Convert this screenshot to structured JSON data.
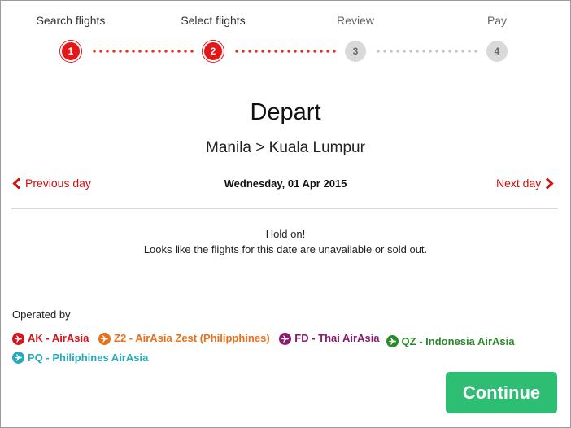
{
  "steps": [
    {
      "label": "Search flights",
      "number": "1",
      "state": "done"
    },
    {
      "label": "Select flights",
      "number": "2",
      "state": "done"
    },
    {
      "label": "Review",
      "number": "3",
      "state": "pending"
    },
    {
      "label": "Pay",
      "number": "4",
      "state": "pending"
    }
  ],
  "header": {
    "title": "Depart",
    "route": "Manila > Kuala Lumpur"
  },
  "date_nav": {
    "previous_label": "Previous day",
    "next_label": "Next day",
    "current_date": "Wednesday, 01 Apr 2015"
  },
  "message": {
    "line1": "Hold on!",
    "line2": "Looks like the flights for this date are unavailable or sold out."
  },
  "operated": {
    "label": "Operated by",
    "airlines": [
      {
        "label": "AK - AirAsia",
        "color": "#d7141a"
      },
      {
        "label": "Z2 - AirAsia Zest (Philipphines)",
        "color": "#e8701a"
      },
      {
        "label": "FD - Thai AirAsia",
        "color": "#8a1a6e"
      },
      {
        "label": "QZ - Indonesia AirAsia",
        "color": "#2a8a2a"
      },
      {
        "label": "PQ - Philiphines AirAsia",
        "color": "#26a9b8"
      }
    ]
  },
  "colors": {
    "accent_red": "#e31717",
    "continue_green": "#2dbd73"
  },
  "continue_label": "Continue"
}
